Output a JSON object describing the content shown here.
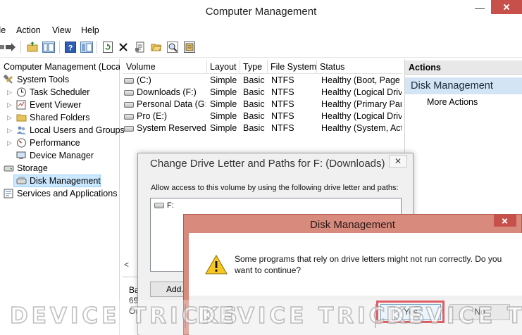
{
  "window": {
    "title": "Computer Management",
    "minimize": "—"
  },
  "menu": [
    "File",
    "Action",
    "View",
    "Help"
  ],
  "toolbar": {
    "icons": [
      "back-arrow-icon",
      "forward-arrow-icon",
      "up-folder-icon",
      "show-hide-tree-icon",
      "help-icon",
      "properties-pane-icon",
      "refresh-icon",
      "delete-icon",
      "properties-icon",
      "open-folder-icon",
      "search-icon",
      "export-list-icon"
    ]
  },
  "tree": {
    "root": "Computer Management (Local",
    "items": [
      {
        "label": "System Tools",
        "icon": "tools-icon",
        "level": 1
      },
      {
        "label": "Task Scheduler",
        "icon": "clock-icon",
        "level": 2
      },
      {
        "label": "Event Viewer",
        "icon": "event-viewer-icon",
        "level": 2
      },
      {
        "label": "Shared Folders",
        "icon": "shared-folder-icon",
        "level": 2
      },
      {
        "label": "Local Users and Groups",
        "icon": "users-icon",
        "level": 2
      },
      {
        "label": "Performance",
        "icon": "performance-icon",
        "level": 2
      },
      {
        "label": "Device Manager",
        "icon": "device-manager-icon",
        "level": 2
      },
      {
        "label": "Storage",
        "icon": "storage-icon",
        "level": 1
      },
      {
        "label": "Disk Management",
        "icon": "disk-icon",
        "level": 2,
        "selected": true
      },
      {
        "label": "Services and Applications",
        "icon": "services-icon",
        "level": 1
      }
    ]
  },
  "volumes": {
    "columns": [
      "Volume",
      "Layout",
      "Type",
      "File System",
      "Status"
    ],
    "rows": [
      [
        "(C:)",
        "Simple",
        "Basic",
        "NTFS",
        "Healthy (Boot, Page F"
      ],
      [
        "Downloads (F:)",
        "Simple",
        "Basic",
        "NTFS",
        "Healthy (Logical Drive"
      ],
      [
        "Personal Data (G:)",
        "Simple",
        "Basic",
        "NTFS",
        "Healthy (Primary Part"
      ],
      [
        "Pro (E:)",
        "Simple",
        "Basic",
        "NTFS",
        "Healthy (Logical Drive"
      ],
      [
        "System Reserved",
        "Simple",
        "Basic",
        "NTFS",
        "Healthy (System, Acti"
      ]
    ],
    "scroll_left": "<",
    "disk_label_fragments": [
      "Ba",
      "69",
      "Or"
    ]
  },
  "actions": {
    "header": "Actions",
    "section": "Disk Management",
    "more": "More Actions"
  },
  "change_letter_dialog": {
    "title": "Change Drive Letter and Paths for F: (Downloads)",
    "close": "✕",
    "prompt": "Allow access to this volume by using the following drive letter and paths:",
    "paths": [
      "F:"
    ],
    "add_button": "Add..."
  },
  "confirm_dialog": {
    "title": "Disk Management",
    "message": "Some programs that rely on drive letters might not run correctly. Do you want to continue?",
    "yes": "Yes",
    "no": "No"
  },
  "watermark": [
    "DEVICE TRICKS",
    "DEVICE TRICKS",
    "DEVICE TRIC"
  ],
  "colors": {
    "selection": "#cce8ff",
    "actions_header_bg": "#e8e8e8",
    "actions_section_bg": "#d3e5f5",
    "dialog_red": "#d88a7d",
    "focus_red": "#d3202a"
  }
}
